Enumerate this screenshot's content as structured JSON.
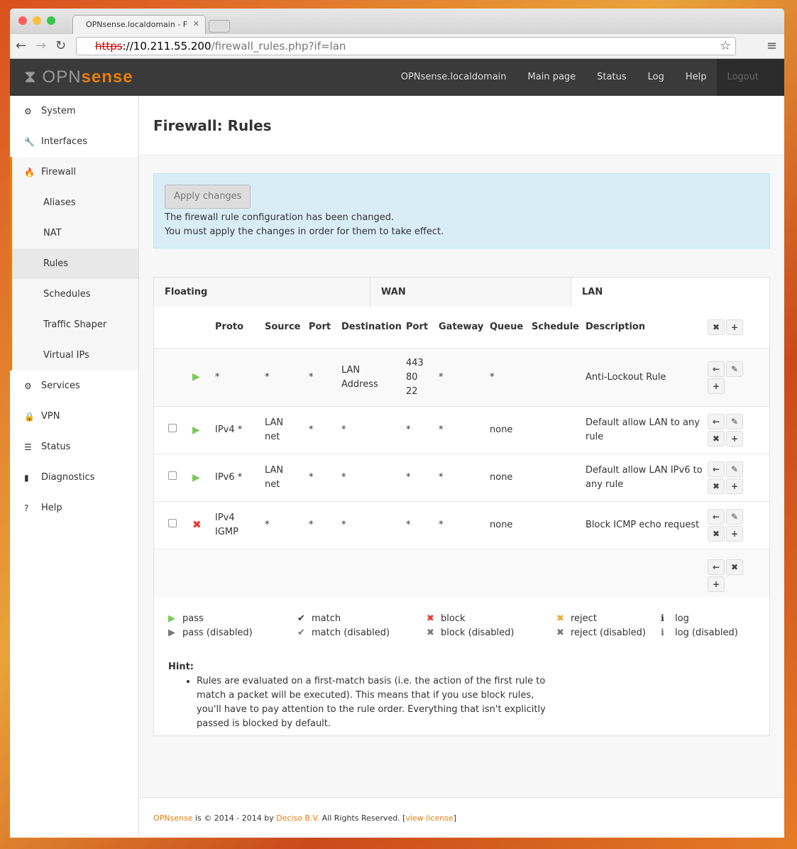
{
  "browser": {
    "tab_title": "OPNsense.localdomain - F",
    "url_scheme": "https",
    "url_host": "://10.211.55.200",
    "url_path": "/firewall_rules.php?if=lan"
  },
  "brand": {
    "logo_text_a": "OPN",
    "logo_text_b": "sense",
    "accent": "#e87d0d"
  },
  "topnav": [
    "OPNsense.localdomain",
    "Main page",
    "Status",
    "Log",
    "Help",
    "Logout"
  ],
  "sidebar": [
    {
      "label": "System",
      "icon": "⚙"
    },
    {
      "label": "Interfaces",
      "icon": "🔧"
    },
    {
      "label": "Firewall",
      "icon": "🔥"
    },
    {
      "label": "Aliases",
      "sub": true
    },
    {
      "label": "NAT",
      "sub": true
    },
    {
      "label": "Rules",
      "sub": true,
      "active": true
    },
    {
      "label": "Schedules",
      "sub": true
    },
    {
      "label": "Traffic Shaper",
      "sub": true
    },
    {
      "label": "Virtual IPs",
      "sub": true
    },
    {
      "label": "Services",
      "icon": "⚙"
    },
    {
      "label": "VPN",
      "icon": "🔒"
    },
    {
      "label": "Status",
      "icon": "☰"
    },
    {
      "label": "Diagnostics",
      "icon": "▮"
    },
    {
      "label": "Help",
      "icon": "?"
    }
  ],
  "page_title": "Firewall: Rules",
  "alert": {
    "button": "Apply changes",
    "line1": "The firewall rule configuration has been changed.",
    "line2": "You must apply the changes in order for them to take effect."
  },
  "tabs": [
    "Floating",
    "WAN",
    "LAN"
  ],
  "columns": [
    "Proto",
    "Source",
    "Port",
    "Destination",
    "Port",
    "Gateway",
    "Queue",
    "Schedule",
    "Description"
  ],
  "rules": [
    {
      "checkbox": false,
      "action": "pass",
      "proto": "*",
      "source": "*",
      "sport": "*",
      "dest": "LAN Address",
      "dport": "443 80 22",
      "gateway": "*",
      "queue": "*",
      "schedule": "",
      "desc": "Anti-Lockout Rule"
    },
    {
      "checkbox": true,
      "action": "pass",
      "proto": "IPv4 *",
      "source": "LAN net",
      "sport": "*",
      "dest": "*",
      "dport": "*",
      "gateway": "*",
      "queue": "none",
      "schedule": "",
      "desc": "Default allow LAN to any rule"
    },
    {
      "checkbox": true,
      "action": "pass",
      "proto": "IPv6 *",
      "source": "LAN net",
      "sport": "*",
      "dest": "*",
      "dport": "*",
      "gateway": "*",
      "queue": "none",
      "schedule": "",
      "desc": "Default allow LAN IPv6 to any rule"
    },
    {
      "checkbox": true,
      "action": "block",
      "proto": "IPv4 IGMP",
      "source": "*",
      "sport": "*",
      "dest": "*",
      "dport": "*",
      "gateway": "*",
      "queue": "none",
      "schedule": "",
      "desc": "Block ICMP echo request"
    }
  ],
  "legend": [
    {
      "icon": "▶",
      "color": "#7cc95a",
      "label": "pass",
      "icon2": "▶",
      "color2": "#777",
      "label2": "pass (disabled)"
    },
    {
      "icon": "✔",
      "color": "#333",
      "label": "match",
      "icon2": "✔",
      "color2": "#777",
      "label2": "match (disabled)"
    },
    {
      "icon": "✖",
      "color": "#e33",
      "label": "block",
      "icon2": "✖",
      "color2": "#777",
      "label2": "block (disabled)"
    },
    {
      "icon": "✖",
      "color": "#f0a830",
      "label": "reject",
      "icon2": "✖",
      "color2": "#777",
      "label2": "reject (disabled)"
    },
    {
      "icon": "ℹ",
      "color": "#333",
      "label": "log",
      "icon2": "ℹ",
      "color2": "#777",
      "label2": "log (disabled)"
    }
  ],
  "hint": {
    "title": "Hint:",
    "text": "Rules are evaluated on a first-match basis (i.e. the action of the first rule to match a packet will be executed). This means that if you use block rules, you'll have to pay attention to the rule order. Everything that isn't explicitly passed is blocked by default."
  },
  "footer": {
    "brand": "OPNsense",
    "mid": " is © 2014 - 2014 by ",
    "company": "Deciso B.V.",
    "rights": " All Rights Reserved. [",
    "license": "view license",
    "end": "]"
  }
}
